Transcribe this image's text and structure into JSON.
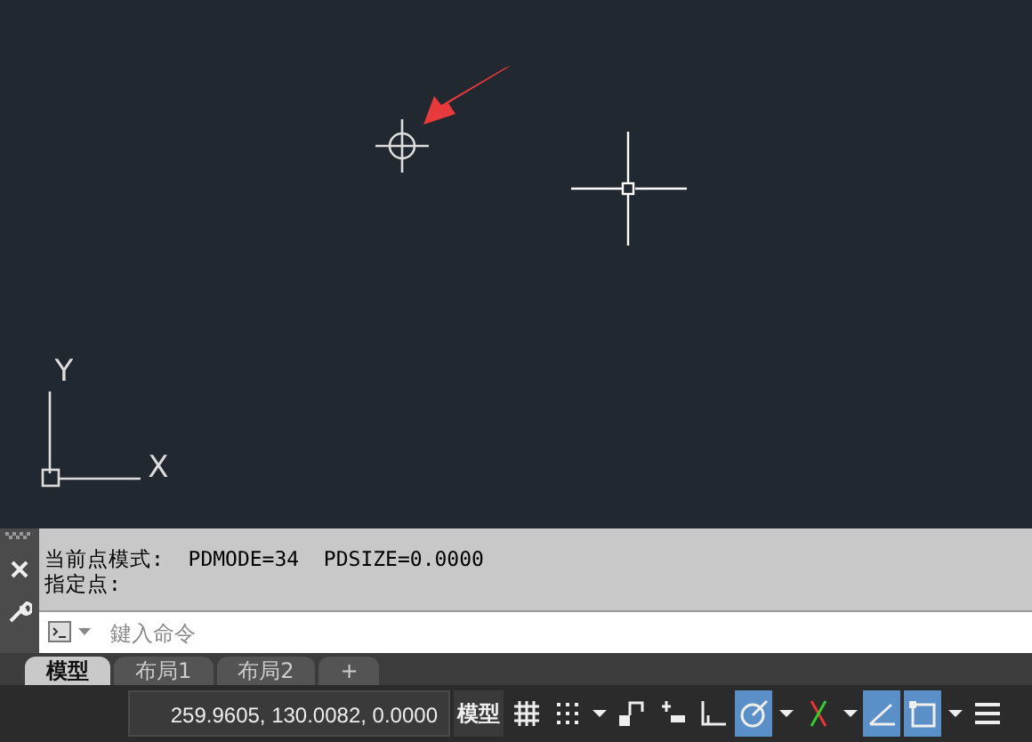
{
  "canvas": {
    "ucs_labels": [
      "Y",
      "X"
    ]
  },
  "command_line": {
    "history": [
      "当前点模式:  PDMODE=34  PDSIZE=0.0000",
      "指定点:"
    ],
    "input": {
      "placeholder": "鍵入命令"
    }
  },
  "layout_tabs": [
    {
      "label": "模型",
      "selected": true
    },
    {
      "label": "布局1",
      "selected": false
    },
    {
      "label": "布局2",
      "selected": false
    },
    {
      "label": "+",
      "selected": false
    }
  ],
  "status_bar": {
    "coordinates": "259.9605, 130.0082, 0.0000",
    "model_button": "模型",
    "tools": [
      {
        "kind": "grid",
        "selected": false
      },
      {
        "kind": "snap",
        "selected": false
      },
      {
        "kind": "dropdown",
        "selected": false
      },
      {
        "kind": "constraint",
        "selected": false
      },
      {
        "kind": "dynamic",
        "selected": false
      },
      {
        "kind": "ortho",
        "selected": false
      },
      {
        "kind": "polar",
        "selected": true
      },
      {
        "kind": "dropdown",
        "selected": false
      },
      {
        "kind": "track",
        "selected": false
      },
      {
        "kind": "dropdown",
        "selected": false
      },
      {
        "kind": "iso",
        "selected": true
      },
      {
        "kind": "select",
        "selected": true
      },
      {
        "kind": "dropdown",
        "selected": false
      },
      {
        "kind": "menu",
        "selected": false
      }
    ]
  }
}
